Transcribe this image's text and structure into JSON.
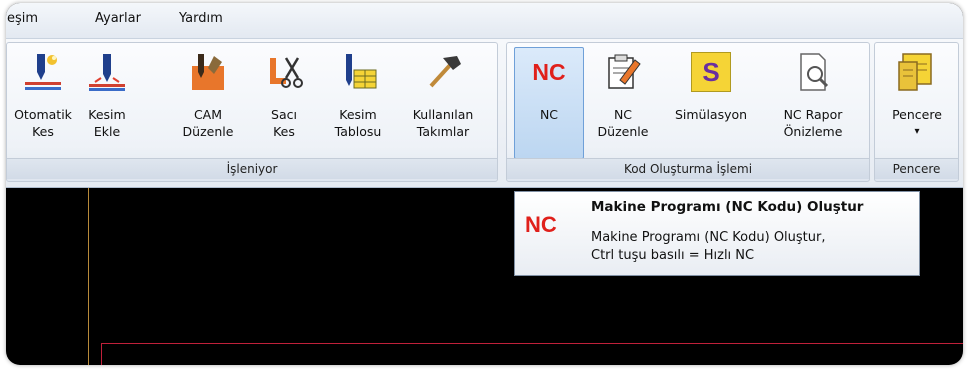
{
  "menu": {
    "items": [
      {
        "label": "eşim"
      },
      {
        "label": "Ayarlar"
      },
      {
        "label": "Yardım"
      }
    ]
  },
  "ribbon": {
    "groups": [
      {
        "label": "İşleniyor",
        "buttons": [
          {
            "line1": "Otomatik",
            "line2": "Kes",
            "icon": "auto-cut-torch-icon"
          },
          {
            "line1": "Kesim",
            "line2": "Ekle",
            "icon": "add-cut-torch-icon"
          },
          {
            "line1": "CAM",
            "line2": "Düzenle",
            "icon": "cam-edit-icon"
          },
          {
            "line1": "Sacı",
            "line2": "Kes",
            "icon": "sheet-cut-scissors-icon"
          },
          {
            "line1": "Kesim",
            "line2": "Tablosu",
            "icon": "cut-table-icon"
          },
          {
            "line1": "Kullanılan",
            "line2": "Takımlar",
            "icon": "hammer-tools-icon"
          }
        ]
      },
      {
        "label": "Kod Oluşturma İşlemi",
        "buttons": [
          {
            "line1": "NC",
            "line2": "",
            "icon": "nc-icon",
            "icon_text": "NC",
            "active": true
          },
          {
            "line1": "NC",
            "line2": "Düzenle",
            "icon": "nc-edit-pencil-icon"
          },
          {
            "line1": "Simülasyon",
            "line2": "",
            "icon": "simulation-icon",
            "icon_text": "S"
          },
          {
            "line1": "NC Rapor",
            "line2": "Önizleme",
            "icon": "report-preview-magnifier-icon"
          }
        ]
      },
      {
        "label": "Pencere",
        "buttons": [
          {
            "line1": "Pencere",
            "line2": "▾",
            "icon": "window-tiles-icon"
          }
        ]
      }
    ]
  },
  "tooltip": {
    "icon_text": "NC",
    "title": "Makine Programı (NC Kodu) Oluştur",
    "line1": "Makine Programı (NC Kodu) Oluştur,",
    "line2": "Ctrl tuşu basılı = Hızlı NC"
  },
  "colors": {
    "nc_red": "#e0201b",
    "active_button": "#bcd6f1",
    "workspace": "#000000"
  }
}
